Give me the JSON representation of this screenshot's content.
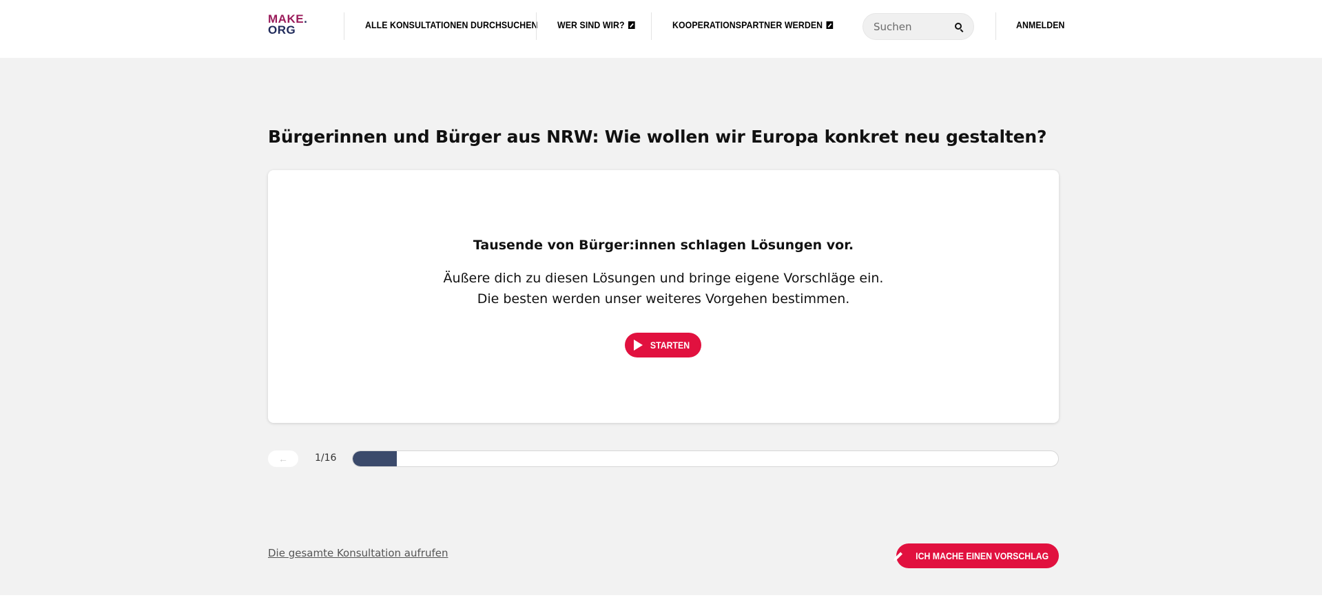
{
  "header": {
    "logo": {
      "line1": "MAKE",
      "dot": ".",
      "line2": "ORG"
    },
    "nav": {
      "all_consultations": "ALLE KONSULTATIONEN DURCHSUCHEN",
      "who_we_are": "WER SIND WIR?",
      "become_partner": "KOOPERATIONSPARTNER WERDEN"
    },
    "search": {
      "placeholder": "Suchen",
      "value": ""
    },
    "login": "ANMELDEN"
  },
  "main": {
    "title": "Bürgerinnen und Bürger aus NRW: Wie wollen wir Europa konkret neu gestalten?",
    "card": {
      "heading": "Tausende von Bürger:innen schlagen Lösungen vor.",
      "line1": "Äußere dich zu diesen Lösungen und bringe eigene Vorschläge ein.",
      "line2": "Die besten werden unser weiteres Vorgehen bestimmen.",
      "start_label": "STARTEN"
    },
    "progress": {
      "label": "1/16",
      "current": 1,
      "total": 16,
      "back_icon": "←"
    }
  },
  "footer": {
    "consultation_link": "Die gesamte Konsultation aufrufen",
    "propose_label": "ICH MACHE EINEN VORSCHLAG"
  },
  "colors": {
    "accent": "#e1113f",
    "progress_fill": "#3b4a6b",
    "logo_top": "#9a1b5a",
    "logo_bottom": "#1f2a5a",
    "background": "#f2f2f2"
  }
}
